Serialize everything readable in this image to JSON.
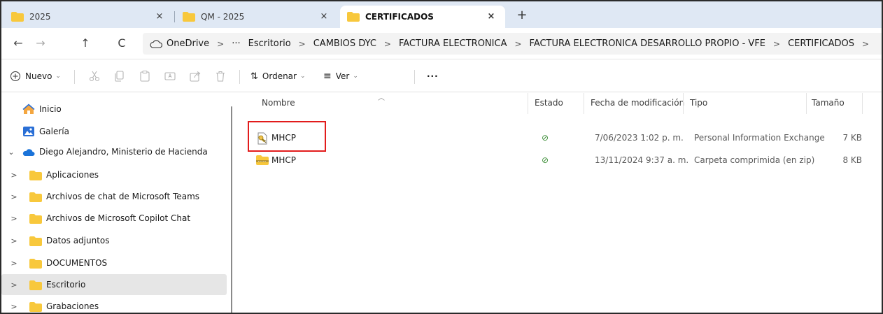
{
  "tabs": [
    {
      "label": "2025",
      "active": false
    },
    {
      "label": "QM - 2025",
      "active": false
    },
    {
      "label": "CERTIFICADOS",
      "active": true
    }
  ],
  "tab_close_glyph": "×",
  "new_tab_glyph": "+",
  "nav": {
    "back": "←",
    "forward": "→",
    "up": "↑",
    "refresh": "C"
  },
  "breadcrumbs": [
    "OneDrive",
    "···",
    "Escritorio",
    "CAMBIOS DYC",
    "FACTURA ELECTRONICA",
    "FACTURA ELECTRONICA DESARROLLO PROPIO - VFE",
    "CERTIFICADOS"
  ],
  "breadcrumb_separator": ">",
  "commandbar": {
    "new_label": "Nuevo",
    "sort_label": "Ordenar",
    "view_label": "Ver",
    "more_label": "···"
  },
  "sidebar": {
    "items": [
      {
        "label": "Inicio",
        "icon": "home-icon",
        "level": 0,
        "chevron": ""
      },
      {
        "label": "Galería",
        "icon": "gallery-icon",
        "level": 0,
        "chevron": ""
      },
      {
        "label": "Diego Alejandro, Ministerio de Hacienda",
        "icon": "onedrive-cloud-icon",
        "level": 0,
        "chevron": "⌄"
      },
      {
        "label": "Aplicaciones",
        "icon": "folder-icon",
        "level": 1,
        "chevron": ">"
      },
      {
        "label": "Archivos de chat de Microsoft Teams",
        "icon": "folder-icon",
        "level": 1,
        "chevron": ">"
      },
      {
        "label": "Archivos de Microsoft Copilot Chat",
        "icon": "folder-icon",
        "level": 1,
        "chevron": ">"
      },
      {
        "label": "Datos adjuntos",
        "icon": "folder-icon",
        "level": 1,
        "chevron": ">"
      },
      {
        "label": "DOCUMENTOS",
        "icon": "folder-icon",
        "level": 1,
        "chevron": ">"
      },
      {
        "label": "Escritorio",
        "icon": "folder-icon",
        "level": 1,
        "chevron": ">",
        "selected": true
      },
      {
        "label": "Grabaciones",
        "icon": "folder-icon",
        "level": 1,
        "chevron": ">"
      }
    ]
  },
  "columns": {
    "name": "Nombre",
    "status": "Estado",
    "modified": "Fecha de modificación",
    "type": "Tipo",
    "size": "Tamaño"
  },
  "files": [
    {
      "name": "MHCP",
      "icon": "certificate-file-icon",
      "status": "⊘",
      "modified": "7/06/2023 1:02 p. m.",
      "type": "Personal Information Exchange",
      "size": "7 KB"
    },
    {
      "name": "MHCP",
      "icon": "zip-folder-icon",
      "status": "⊘",
      "modified": "13/11/2024 9:37 a. m.",
      "type": "Carpeta comprimida (en zip)",
      "size": "8 KB"
    }
  ],
  "colors": {
    "accent": "#0067c0",
    "folder": "#f8c83c",
    "status_green": "#3f8f3a",
    "highlight": "#e21c1c"
  }
}
